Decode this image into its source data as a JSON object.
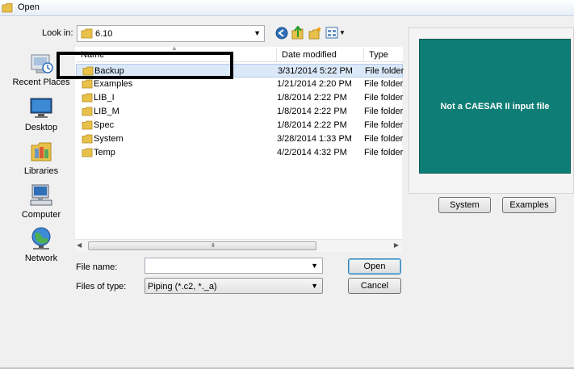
{
  "window": {
    "title": "Open"
  },
  "look_in": {
    "label": "Look in:",
    "value": "6.10"
  },
  "places": [
    {
      "label": "Recent Places",
      "icon": "recent-places-icon"
    },
    {
      "label": "Desktop",
      "icon": "desktop-icon"
    },
    {
      "label": "Libraries",
      "icon": "libraries-icon"
    },
    {
      "label": "Computer",
      "icon": "computer-icon"
    },
    {
      "label": "Network",
      "icon": "network-icon"
    }
  ],
  "file_list": {
    "columns": [
      "Name",
      "Date modified",
      "Type"
    ],
    "rows": [
      {
        "name": "Backup",
        "date": "3/31/2014 5:22 PM",
        "type": "File folder",
        "selected": true
      },
      {
        "name": "Examples",
        "date": "1/21/2014 2:20 PM",
        "type": "File folder"
      },
      {
        "name": "LIB_I",
        "date": "1/8/2014 2:22 PM",
        "type": "File folder"
      },
      {
        "name": "LIB_M",
        "date": "1/8/2014 2:22 PM",
        "type": "File folder"
      },
      {
        "name": "Spec",
        "date": "1/8/2014 2:22 PM",
        "type": "File folder"
      },
      {
        "name": "System",
        "date": "3/28/2014 1:33 PM",
        "type": "File folder"
      },
      {
        "name": "Temp",
        "date": "4/2/2014 4:32 PM",
        "type": "File folder"
      }
    ]
  },
  "scrollbar": {
    "grip": "III"
  },
  "file_name": {
    "label": "File name:",
    "value": ""
  },
  "file_type": {
    "label": "Files of type:",
    "value": "Piping (*.c2, *._a)"
  },
  "buttons": {
    "open": "Open",
    "cancel": "Cancel",
    "system": "System",
    "examples": "Examples"
  },
  "preview": {
    "text": "Not a CAESAR II input file"
  },
  "colors": {
    "preview_bg": "#0e7d75",
    "selection": "#dbe8f8",
    "folder": "#e8c14a"
  }
}
